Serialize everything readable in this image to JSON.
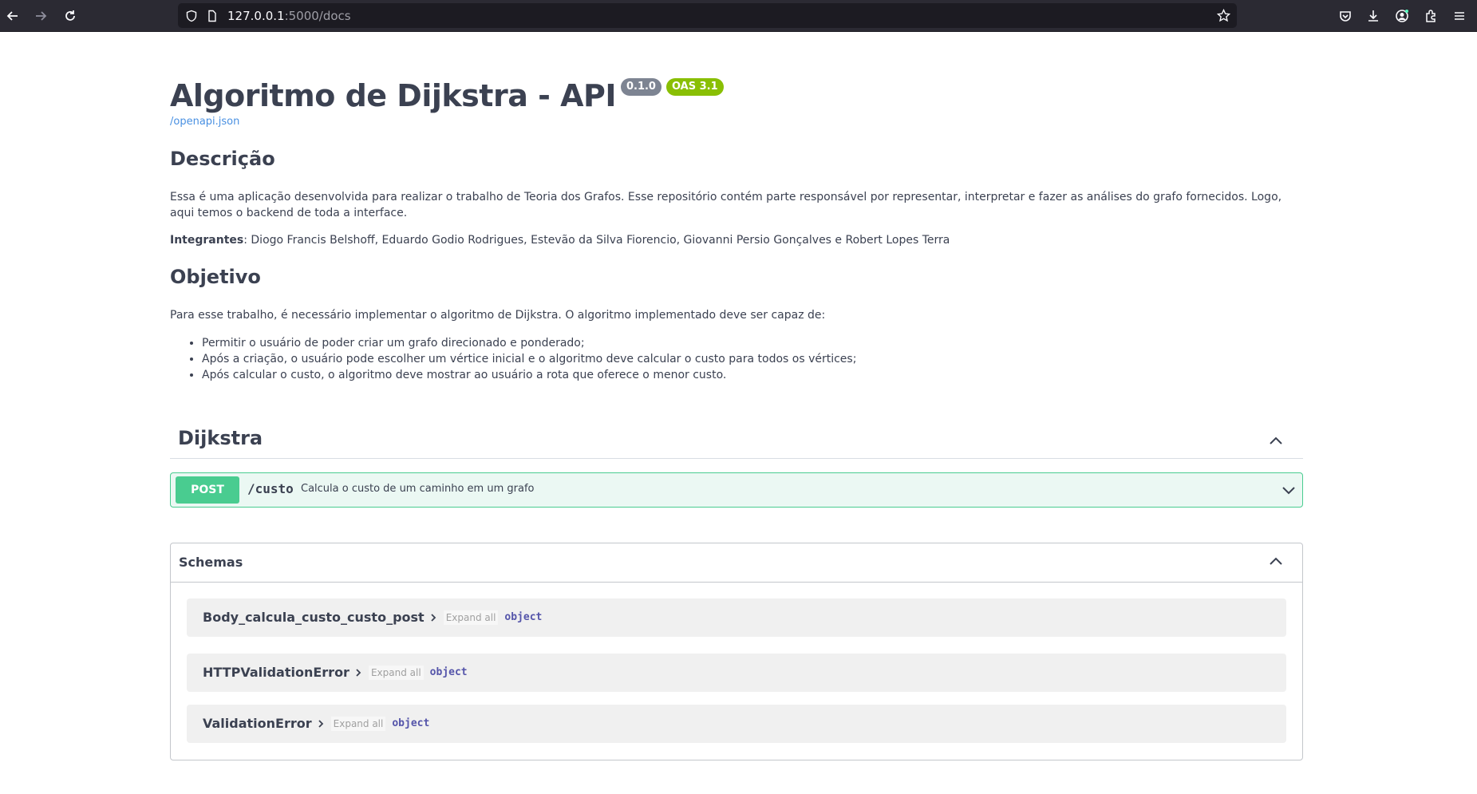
{
  "browser": {
    "url_host": "127.0.0.1",
    "url_rest": ":5000/docs"
  },
  "header": {
    "title": "Algoritmo de Dijkstra - API",
    "version_badge": "0.1.0",
    "oas_badge": "OAS 3.1",
    "openapi_link": "/openapi.json"
  },
  "description": {
    "heading": "Descrição",
    "paragraph": "Essa é uma aplicação desenvolvida para realizar o trabalho de Teoria dos Grafos. Esse repositório contém parte responsável por representar, interpretar e fazer as análises do grafo fornecidos. Logo, aqui temos o backend de toda a interface.",
    "members_label": "Integrantes",
    "members": ": Diogo Francis Belshoff, Eduardo Godio Rodrigues, Estevão da Silva Fiorencio, Giovanni Persio Gonçalves e Robert Lopes Terra"
  },
  "objective": {
    "heading": "Objetivo",
    "intro": "Para esse trabalho, é necessário implementar o algoritmo de Dijkstra. O algoritmo implementado deve ser capaz de:",
    "items": [
      "Permitir o usuário de poder criar um grafo direcionado e ponderado;",
      "Após a criação, o usuário pode escolher um vértice inicial e o algoritmo deve calcular o custo para todos os vértices;",
      "Após calcular o custo, o algoritmo deve mostrar ao usuário a rota que oferece o menor custo."
    ]
  },
  "operations": {
    "tag": "Dijkstra",
    "endpoint": {
      "method": "POST",
      "path": "/custo",
      "summary": "Calcula o custo de um caminho em um grafo"
    }
  },
  "schemas": {
    "title": "Schemas",
    "expand_label": "Expand all",
    "items": [
      {
        "name": "Body_calcula_custo_custo_post",
        "type": "object"
      },
      {
        "name": "HTTPValidationError",
        "type": "object"
      },
      {
        "name": "ValidationError",
        "type": "object"
      }
    ]
  },
  "colors": {
    "post": "#49cc90",
    "post_bg": "#ebf8f3",
    "oas_badge": "#89bf04",
    "version_badge": "#7d8492",
    "link": "#4990e2"
  }
}
